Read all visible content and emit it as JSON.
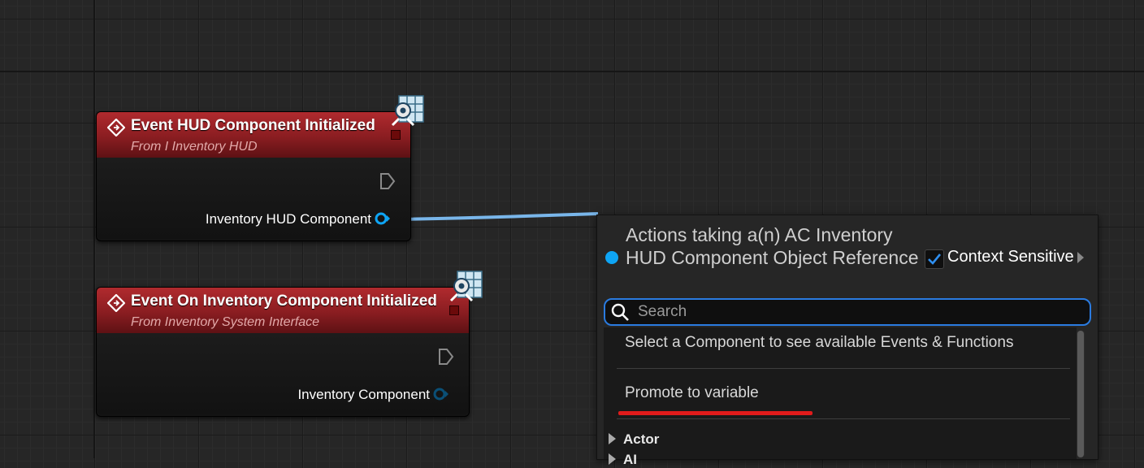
{
  "nodes": {
    "hud": {
      "title": "Event HUD Component Initialized",
      "subtitle": "From I Inventory HUD",
      "output_pin_label": "Inventory HUD Component"
    },
    "inventory": {
      "title": "Event On Inventory Component Initialized",
      "subtitle": "From Inventory System Interface",
      "output_pin_label": "Inventory Component"
    }
  },
  "action_menu": {
    "heading": "Actions taking a(n) AC Inventory HUD Component Object Reference",
    "context_sensitive_label": "Context Sensitive",
    "context_sensitive_checked": true,
    "search_placeholder": "Search",
    "search_value": "",
    "items": [
      "Select a Component to see available Events & Functions",
      "Promote to variable"
    ],
    "categories": [
      "Actor",
      "AI"
    ]
  },
  "colors": {
    "event_header": "#9f2226",
    "object_pin": "#0ea5f5",
    "wire": "#79b6ea",
    "search_focus": "#2a7be0",
    "highlight_underline": "#e01b1b"
  },
  "icons": [
    "event-diamond-icon",
    "interface-badge-icon",
    "exec-pin-icon",
    "object-pin-icon",
    "checkmark-icon",
    "search-icon",
    "expand-arrow-icon"
  ]
}
